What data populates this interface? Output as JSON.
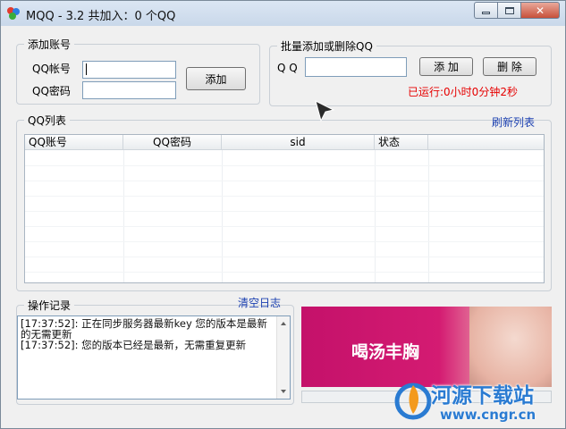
{
  "window": {
    "title": "MQQ - 3.2 共加入：0  个QQ"
  },
  "add_account": {
    "legend": "添加账号",
    "qq_label": "QQ帐号",
    "password_label": "QQ密码",
    "qq_value": "",
    "password_value": "",
    "add_button": "添加"
  },
  "batch": {
    "legend": "批量添加或删除QQ",
    "qq_label": "Q Q",
    "qq_value": "",
    "add_button": "添 加",
    "delete_button": "删 除",
    "runtime": "已运行:0小时0分钟2秒"
  },
  "qq_list": {
    "legend": "QQ列表",
    "refresh_link": "刷新列表",
    "columns": [
      "QQ账号",
      "QQ密码",
      "sid",
      "状态"
    ]
  },
  "log": {
    "legend": "操作记录",
    "clear_link": "清空日志",
    "lines": [
      "[17:37:52]: 正在同步服务器最新key 您的版本是最新的无需更新",
      "[17:37:52]: 您的版本已经是最新，无需重复更新"
    ]
  },
  "ad": {
    "text": "喝汤丰胸"
  },
  "watermark": {
    "text": "河源下载站",
    "url": "www.cngr.cn"
  },
  "colors": {
    "link": "#1a3fb0",
    "runtime": "#e60000",
    "ad_bg": "#c4116a"
  }
}
